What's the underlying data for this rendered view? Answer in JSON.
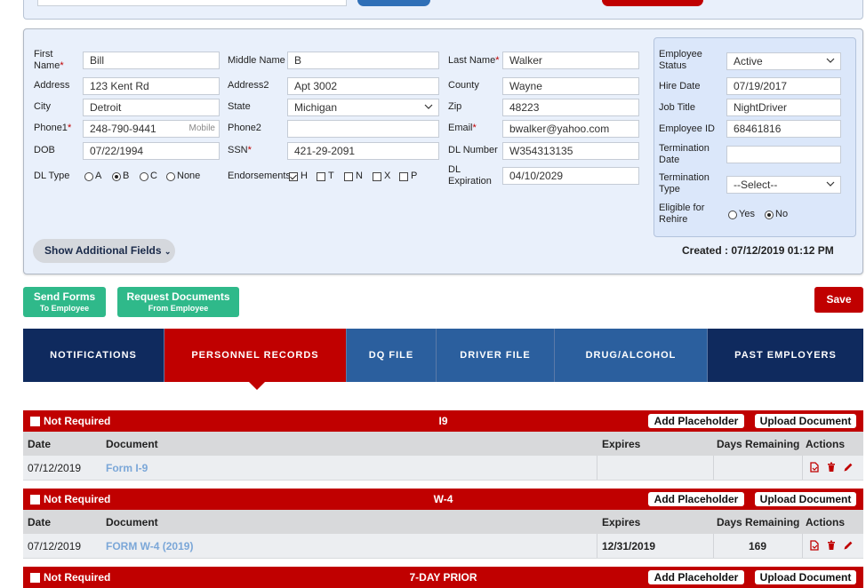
{
  "form": {
    "first_name_label": "First Name",
    "first_name": "Bill",
    "middle_name_label": "Middle Name",
    "middle_name": "B",
    "last_name_label": "Last Name",
    "last_name": "Walker",
    "address_label": "Address",
    "address": "123 Kent Rd",
    "address2_label": "Address2",
    "address2": "Apt 3002",
    "county_label": "County",
    "county": "Wayne",
    "city_label": "City",
    "city": "Detroit",
    "state_label": "State",
    "state": "Michigan",
    "zip_label": "Zip",
    "zip": "48223",
    "phone1_label": "Phone1",
    "phone1": "248-790-9441",
    "phone1_type": "Mobile",
    "phone2_label": "Phone2",
    "phone2": "",
    "email_label": "Email",
    "email": "bwalker@yahoo.com",
    "dob_label": "DOB",
    "dob": "07/22/1994",
    "ssn_label": "SSN",
    "ssn": "421-29-2091",
    "dl_number_label": "DL Number",
    "dl_number": "W354313135",
    "dl_type_label": "DL Type",
    "dl_type_options": [
      "A",
      "B",
      "C",
      "None"
    ],
    "dl_type_selected": "B",
    "endorsements_label": "Endorsements",
    "endorsement_options": [
      "H",
      "T",
      "N",
      "X",
      "P"
    ],
    "endorsement_checked": [
      "H"
    ],
    "dl_expiration_label": "DL Expiration",
    "dl_expiration": "04/10/2029"
  },
  "employee": {
    "status_label": "Employee Status",
    "status": "Active",
    "hire_date_label": "Hire Date",
    "hire_date": "07/19/2017",
    "job_title_label": "Job Title",
    "job_title": "NightDriver",
    "employee_id_label": "Employee ID",
    "employee_id": "68461816",
    "termination_date_label": "Termination Date",
    "termination_date": "",
    "termination_type_label": "Termination Type",
    "termination_type": "--Select--",
    "eligible_label": "Eligible for Rehire",
    "eligible_options": [
      "Yes",
      "No"
    ],
    "eligible_selected": "No"
  },
  "show_additional_label": "Show Additional Fields",
  "created": "Created : 07/12/2019 01:12 PM",
  "buttons": {
    "send_forms_l1": "Send Forms",
    "send_forms_l2": "To Employee",
    "request_docs_l1": "Request Documents",
    "request_docs_l2": "From Employee",
    "save": "Save"
  },
  "tabs": [
    {
      "label": "NOTIFICATIONS"
    },
    {
      "label": "PERSONNEL RECORDS"
    },
    {
      "label": "DQ FILE"
    },
    {
      "label": "DRIVER FILE"
    },
    {
      "label": "DRUG/ALCOHOL"
    },
    {
      "label": "PAST EMPLOYERS"
    }
  ],
  "section_labels": {
    "not_required": "Not Required",
    "add_placeholder": "Add Placeholder",
    "upload_document": "Upload Document"
  },
  "columns": {
    "date": "Date",
    "document": "Document",
    "expires": "Expires",
    "days_remaining": "Days Remaining",
    "actions": "Actions"
  },
  "sections": [
    {
      "title": "I9",
      "row": {
        "date": "07/12/2019",
        "document": "Form I-9",
        "expires": "",
        "days": ""
      }
    },
    {
      "title": "W-4",
      "row": {
        "date": "07/12/2019",
        "document": "FORM W-4 (2019)",
        "expires": "12/31/2019",
        "days": "169"
      }
    },
    {
      "title": "7-DAY PRIOR"
    }
  ],
  "colors": {
    "red": "#c00000",
    "navy": "#0f2a5e",
    "blue": "#2b5f9e",
    "green": "#2fb98a",
    "panel": "#e9f0fb"
  }
}
